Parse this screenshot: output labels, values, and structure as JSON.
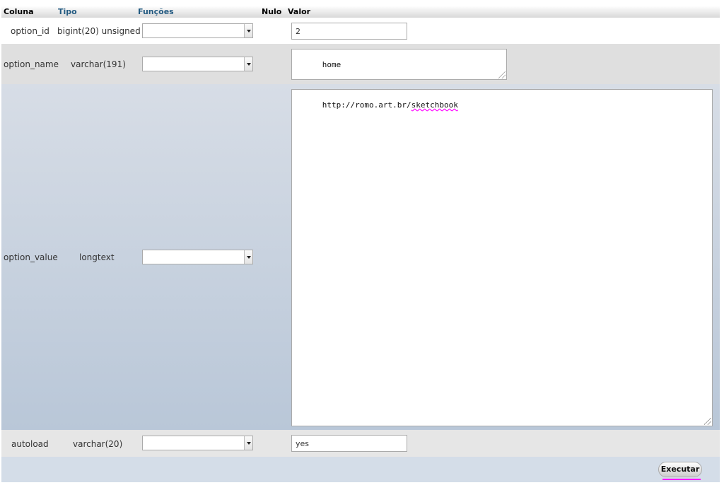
{
  "header": {
    "coluna": "Coluna",
    "tipo": "Tipo",
    "funcoes": "Funções",
    "nulo": "Nulo",
    "valor": "Valor"
  },
  "rows": [
    {
      "column": "option_id",
      "type": "bigint(20) unsigned",
      "function": "",
      "value": "2"
    },
    {
      "column": "option_name",
      "type": "varchar(191)",
      "function": "",
      "value": "home"
    },
    {
      "column": "option_value",
      "type": "longtext",
      "function": "",
      "value_prefix": "http://romo.art.br/",
      "value_misspelled": "sketchbook"
    },
    {
      "column": "autoload",
      "type": "varchar(20)",
      "function": "",
      "value": "yes"
    }
  ],
  "actions": {
    "execute_label": "Executar"
  }
}
